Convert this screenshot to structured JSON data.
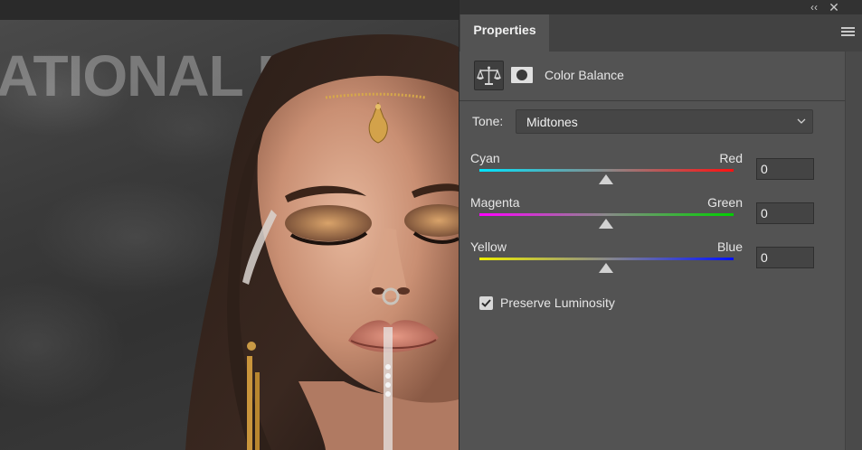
{
  "canvas": {
    "watermark_text": "ATIONAL PURPO"
  },
  "panel": {
    "window_controls": {
      "collapse_icon": "double-chevron-left-icon",
      "close_icon": "close-icon",
      "collapse_glyph": "‹‹",
      "close_glyph": "✕"
    },
    "tab_label": "Properties",
    "menu_icon": "hamburger-menu-icon",
    "adjustment_title": "Color Balance",
    "adjustment_icons": [
      "balance-scale-icon",
      "layer-mask-icon"
    ],
    "tone": {
      "label": "Tone:",
      "value": "Midtones"
    },
    "sliders": [
      {
        "left": "Cyan",
        "right": "Red",
        "value": "0",
        "left_color": "#00e5ff",
        "right_color": "#ff1010"
      },
      {
        "left": "Magenta",
        "right": "Green",
        "value": "0",
        "left_color": "#ff00ff",
        "right_color": "#00d000"
      },
      {
        "left": "Yellow",
        "right": "Blue",
        "value": "0",
        "left_color": "#f0f000",
        "right_color": "#0010ff"
      }
    ],
    "preserve_luminosity": {
      "label": "Preserve Luminosity",
      "checked": true
    }
  },
  "colors": {
    "panel_bg": "#535353",
    "tab_bar": "#424242",
    "canvas_bg": "#3a3a3a"
  }
}
